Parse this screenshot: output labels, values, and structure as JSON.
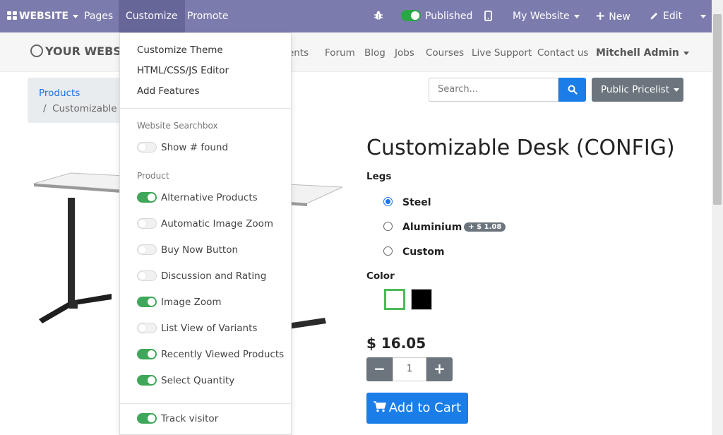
{
  "topbar": {
    "website_label": "WEBSITE",
    "pages_label": "Pages",
    "customize_label": "Customize",
    "promote_label": "Promote",
    "published_label": "Published",
    "site_label": "My Website",
    "new_label": "New",
    "edit_label": "Edit",
    "bg_color": "#7c7bad"
  },
  "subnav": {
    "logo_text": "YOUR WEBSITE",
    "links": [
      "vents",
      "Forum",
      "Blog",
      "Jobs",
      "Courses",
      "Live Support",
      "Contact us"
    ],
    "user": "Mitchell Admin"
  },
  "breadcrumb": {
    "items": [
      "Products",
      "Customizable Desk (CONFIG)"
    ]
  },
  "search": {
    "placeholder": "Search..."
  },
  "pricelist": {
    "label": "Public Pricelist"
  },
  "product": {
    "title": "Customizable Desk (CONFIG)",
    "legs_label": "Legs",
    "legs_options": [
      {
        "label": "Steel",
        "checked": true,
        "extra": ""
      },
      {
        "label": "Aluminium",
        "checked": false,
        "extra": "+ $ 1.08"
      },
      {
        "label": "Custom",
        "checked": false,
        "extra": ""
      }
    ],
    "color_label": "Color",
    "colors": [
      "#ffffff",
      "#000000"
    ],
    "selected_color": "#ffffff",
    "price": "$ 16.05",
    "quantity": "1",
    "add_to_cart": "Add to Cart"
  },
  "customize_menu": {
    "items": [
      "Customize Theme",
      "HTML/CSS/JS Editor",
      "Add Features"
    ],
    "searchbox_header": "Website Searchbox",
    "searchbox_options": [
      {
        "label": "Show # found",
        "on": false
      }
    ],
    "product_header": "Product",
    "product_options": [
      {
        "label": "Alternative Products",
        "on": true
      },
      {
        "label": "Automatic Image Zoom",
        "on": false
      },
      {
        "label": "Buy Now Button",
        "on": false
      },
      {
        "label": "Discussion and Rating",
        "on": false
      },
      {
        "label": "Image Zoom",
        "on": true
      },
      {
        "label": "List View of Variants",
        "on": false
      },
      {
        "label": "Recently Viewed Products",
        "on": true
      },
      {
        "label": "Select Quantity",
        "on": true
      }
    ],
    "extra_options": [
      {
        "label": "Track visitor",
        "on": true
      }
    ]
  }
}
